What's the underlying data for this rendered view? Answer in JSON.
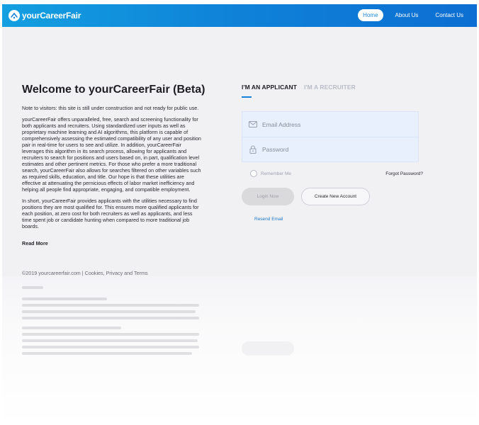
{
  "brand": {
    "name": "yourCareerFair",
    "logo_icon": "career-fair-logo-icon"
  },
  "nav": {
    "links": [
      {
        "label": "Home",
        "active": true
      },
      {
        "label": "About Us",
        "active": false
      },
      {
        "label": "Contact Us",
        "active": false
      }
    ]
  },
  "intro": {
    "title": "Welcome to yourCareerFair (Beta)",
    "notice": "Note to visitors: this site is still under construction and not ready for public use.",
    "paragraph1": "yourCareerFair offers unparalleled, free, search and screening functionality for both applicants and recruiters. Using standardized user inputs as well as proprietary machine learning and AI algorithms, this platform is capable of comprehensively assessing the estimated compatibility of any user and position pair in real-time for users to see and utilize. In addition, yourCareerFair leverages this algorithm in its search process, allowing for applicants and recruiters to search for positions and users based on, in part, qualification level estimates and other pertinent metrics. For those who prefer a more traditional search, yourCareerFair also allows for searches filtered on other variables such as required skills, education, and title. Our hope is that these utilities are effective at attenuating the pernicious effects of labor market inefficiency and helping all people find appropriate, engaging, and compatible employment.",
    "paragraph2": "In short, yourCareerFair provides applicants with the utilities necessary to find positions they are most qualified for. This ensures more qualified applicants for each position, at zero cost for both recruiters as well as applicants, and less time spent job or candidate hunting when compared to more traditional job boards.",
    "read_more": "Read More"
  },
  "footer": {
    "text": "©2019 yourcareerfair.com | Cookies, Privacy and Terms"
  },
  "login": {
    "tabs": [
      {
        "label": "I'M AN APPLICANT",
        "active": true
      },
      {
        "label": "I'M A RECRUITER",
        "active": false
      }
    ],
    "email_placeholder": "Email Address",
    "email_icon": "envelope-icon",
    "password_placeholder": "Password",
    "password_icon": "lock-icon",
    "remember_me": "Remember Me",
    "forgot_password": "Forgot Password?",
    "login_button": "Login Now",
    "create_account_button": "Create New Account",
    "resend_email": "Resend Email"
  },
  "colors": {
    "nav_gradient_start": "#139fe0",
    "nav_gradient_end": "#0c6ed2",
    "accent": "#1583d9",
    "page_background": "#f1f1f4",
    "form_background": "#e8f0fd"
  }
}
